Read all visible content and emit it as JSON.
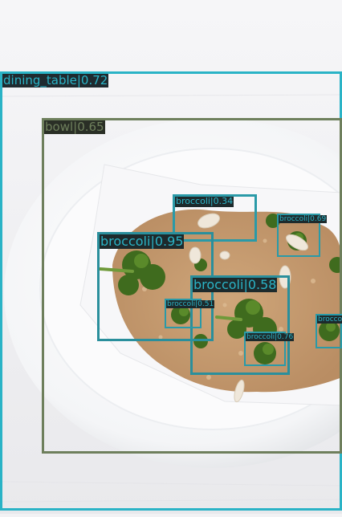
{
  "image": {
    "description_icon": "photo-broccoli-quinoa-in-white-bowl"
  },
  "detections": [
    {
      "label": "dining_table|0.72",
      "color": "#2ab3c6",
      "text_color": "#2ab3c6",
      "bg": "#1f2a2f",
      "border": 3,
      "size": 15
    },
    {
      "label": "bowl|0.65",
      "color": "#6e7f5c",
      "text_color": "#6e7f5c",
      "bg": "#2a2f26",
      "border": 3,
      "size": 15
    },
    {
      "label": "broccoli|0.34",
      "color": "#2a9aa8",
      "text_color": "#2ab3c6",
      "bg": "#1d2a2c",
      "border": 3,
      "size": 11
    },
    {
      "label": "broccoli|0.69",
      "color": "#2a9aa8",
      "text_color": "#2ab3c6",
      "bg": "#1d2a2c",
      "border": 2,
      "size": 9
    },
    {
      "label": "broccoli|0.95",
      "color": "#2a8f9c",
      "text_color": "#2ab3c6",
      "bg": "#1d2a2c",
      "border": 3,
      "size": 16
    },
    {
      "label": "broccoli|0.58",
      "color": "#2a8f9c",
      "text_color": "#2ab3c6",
      "bg": "#1d2a2c",
      "border": 3,
      "size": 16
    },
    {
      "label": "broccoli|0.51",
      "color": "#2a9aa8",
      "text_color": "#2ab3c6",
      "bg": "#1d2a2c",
      "border": 2,
      "size": 9
    },
    {
      "label": "broccoli|0.76",
      "color": "#2a9aa8",
      "text_color": "#2ab3c6",
      "bg": "#1d2a2c",
      "border": 2,
      "size": 9
    },
    {
      "label": "broccoli",
      "color": "#2a9aa8",
      "text_color": "#2ab3c6",
      "bg": "#1d2a2c",
      "border": 2,
      "size": 9
    }
  ]
}
